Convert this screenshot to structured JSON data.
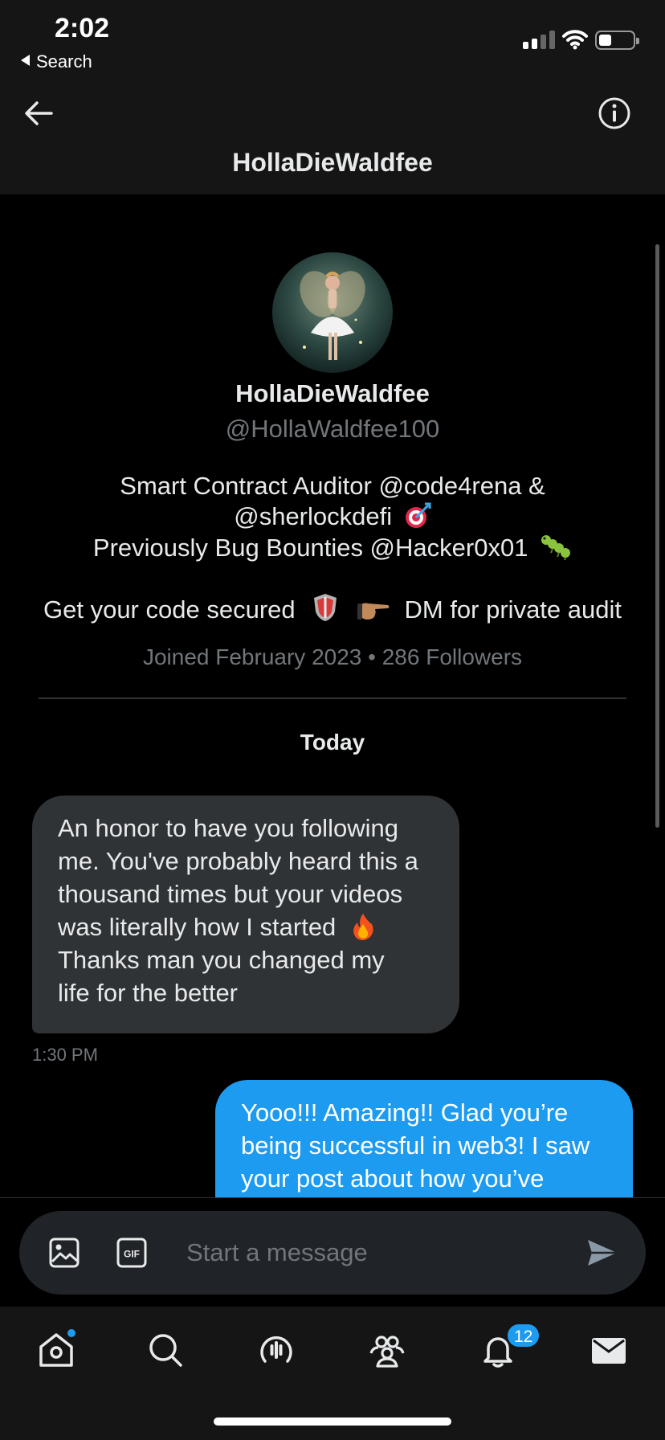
{
  "status_bar": {
    "time": "2:02",
    "back_label": "Search"
  },
  "header": {
    "title": "HollaDieWaldfee",
    "back_icon": "back-arrow-icon",
    "info_icon": "info-icon"
  },
  "profile": {
    "name": "HollaDieWaldfee",
    "handle": "@HollaWaldfee100",
    "bio_line1": "Smart Contract Auditor @code4rena &",
    "bio_line2": "@sherlockdefi",
    "bio_line3": "Previously Bug Bounties @Hacker0x01",
    "bio_line4_a": "Get your code secured",
    "bio_line4_b": "DM for private audit",
    "joined": "Joined February 2023",
    "followers": "286 Followers",
    "meta_separator": "•"
  },
  "conversation": {
    "day_label": "Today",
    "messages": [
      {
        "direction": "incoming",
        "lines": [
          "An honor to have you following",
          "me. You've probably heard this a",
          "thousand times but your videos",
          "was literally how I started",
          "Thanks man you changed my",
          "life for the better"
        ],
        "time": "1:30 PM"
      },
      {
        "direction": "outgoing",
        "lines": [
          "Yooo!!! Amazing!! Glad you’re",
          "being successful in web3! I saw",
          "your post about how you’ve"
        ]
      }
    ]
  },
  "composer": {
    "placeholder": "Start a message",
    "media_icon": "image-icon",
    "gif_label": "GIF",
    "send_icon": "send-icon"
  },
  "tabbar": {
    "items": [
      "home",
      "search",
      "spaces",
      "communities",
      "notifications",
      "messages"
    ],
    "notifications_badge": "12"
  },
  "colors": {
    "accent": "#1d9bf0",
    "background": "#000000",
    "bubble_incoming": "#2f3336",
    "muted_text": "#71767b"
  }
}
